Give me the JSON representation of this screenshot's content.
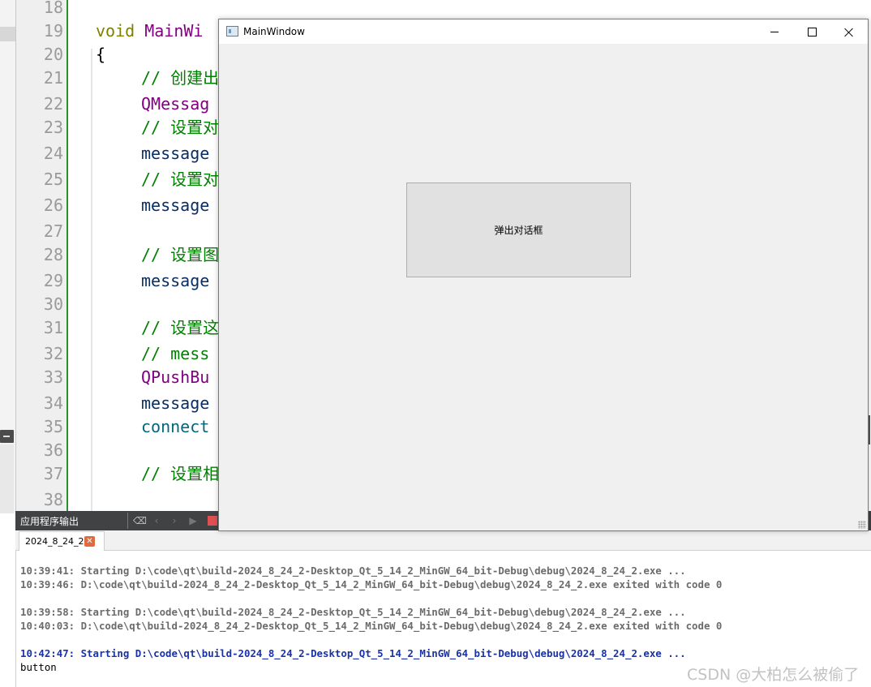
{
  "editor": {
    "line_numbers": [
      "18",
      "19",
      "20",
      "21",
      "22",
      "23",
      "24",
      "25",
      "26",
      "27",
      "28",
      "29",
      "30",
      "31",
      "32",
      "33",
      "34",
      "35",
      "36",
      "37",
      "38"
    ],
    "code": {
      "l19_kw": "void",
      "l19_fn": "MainWi",
      "l20": "{",
      "l21": "// 创建出",
      "l22": "QMessag",
      "l23": "// 设置对",
      "l24": "message",
      "l25": "// 设置对",
      "l26": "message",
      "l28": "// 设置图",
      "l29": "message",
      "l31": "// 设置这",
      "l32": "// mess",
      "l33": "QPushBu",
      "l34": "message",
      "l35": "connect",
      "l37": "// 设置相"
    }
  },
  "output_pane": {
    "title": "应用程序输出",
    "tab_label": "2024_8_24_2",
    "lines": [
      {
        "text": "10:39:41: Starting D:\\code\\qt\\build-2024_8_24_2-Desktop_Qt_5_14_2_MinGW_64_bit-Debug\\debug\\2024_8_24_2.exe ...",
        "style": "gray"
      },
      {
        "text": "10:39:46: D:\\code\\qt\\build-2024_8_24_2-Desktop_Qt_5_14_2_MinGW_64_bit-Debug\\debug\\2024_8_24_2.exe exited with code 0",
        "style": "gray"
      },
      {
        "text": "10:39:58: Starting D:\\code\\qt\\build-2024_8_24_2-Desktop_Qt_5_14_2_MinGW_64_bit-Debug\\debug\\2024_8_24_2.exe ...",
        "style": "gray"
      },
      {
        "text": "10:40:03: D:\\code\\qt\\build-2024_8_24_2-Desktop_Qt_5_14_2_MinGW_64_bit-Debug\\debug\\2024_8_24_2.exe exited with code 0",
        "style": "gray"
      },
      {
        "text": "10:42:47: Starting D:\\code\\qt\\build-2024_8_24_2-Desktop_Qt_5_14_2_MinGW_64_bit-Debug\\debug\\2024_8_24_2.exe ...",
        "style": "blue"
      },
      {
        "text": "button",
        "style": "plain"
      }
    ]
  },
  "main_window": {
    "title": "MainWindow",
    "button_label": "弹出对话框"
  },
  "watermark": "CSDN @大柏怎么被偷了"
}
